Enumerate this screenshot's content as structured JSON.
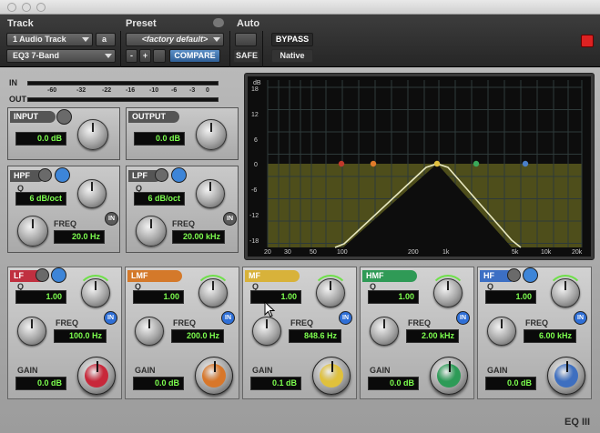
{
  "header": {
    "track_label": "Track",
    "preset_label": "Preset",
    "auto_label": "Auto",
    "track_name": "1 Audio Track",
    "track_sub": "a",
    "plugin_name": "EQ3 7-Band",
    "preset_value": "<factory default>",
    "minus": "-",
    "plus": "+",
    "compare": "COMPARE",
    "safe": "SAFE",
    "bypass": "BYPASS",
    "native": "Native"
  },
  "meters": {
    "in_label": "IN",
    "out_label": "OUT",
    "scale": [
      "-60",
      "-32",
      "-22",
      "-16",
      "-10",
      "-6",
      "-3",
      "0"
    ]
  },
  "input": {
    "label": "INPUT",
    "value": "0.0 dB"
  },
  "output": {
    "label": "OUTPUT",
    "value": "0.0 dB"
  },
  "hpf": {
    "label": "HPF",
    "q_label": "Q",
    "q_value": "6 dB/oct",
    "freq_label": "FREQ",
    "freq_value": "20.0 Hz",
    "in": "IN"
  },
  "lpf": {
    "label": "LPF",
    "q_label": "Q",
    "q_value": "6 dB/oct",
    "freq_label": "FREQ",
    "freq_value": "20.00 kHz",
    "in": "IN"
  },
  "graph": {
    "db_label": "dB",
    "y_ticks": [
      "18",
      "12",
      "6",
      "0",
      "-6",
      "-12",
      "-18"
    ],
    "x_ticks": [
      "20",
      "30",
      "50",
      "100",
      "200",
      "1k",
      "5k",
      "10k",
      "20k"
    ],
    "curve_color": "#e8e8c0",
    "band_colors": [
      "#c0392b",
      "#e07b2a",
      "#e0c040",
      "#3aa85a",
      "#4a7fc8"
    ]
  },
  "bands": [
    {
      "label": "LF",
      "color": "#c03040",
      "q_label": "Q",
      "q_value": "1.00",
      "freq_label": "FREQ",
      "freq_value": "100.0 Hz",
      "gain_label": "GAIN",
      "gain_value": "0.0 dB",
      "in": "IN",
      "knob_color": "#c8283a"
    },
    {
      "label": "LMF",
      "color": "#d4792a",
      "q_label": "Q",
      "q_value": "1.00",
      "freq_label": "FREQ",
      "freq_value": "200.0 Hz",
      "gain_label": "GAIN",
      "gain_value": "0.0 dB",
      "in": "IN",
      "knob_color": "#d8772a"
    },
    {
      "label": "MF",
      "color": "#d8b23a",
      "q_label": "Q",
      "q_value": "1.00",
      "freq_label": "FREQ",
      "freq_value": "848.6 Hz",
      "gain_label": "GAIN",
      "gain_value": "0.1 dB",
      "in": "IN",
      "knob_color": "#e0c13c"
    },
    {
      "label": "HMF",
      "color": "#2f9a56",
      "q_label": "Q",
      "q_value": "1.00",
      "freq_label": "FREQ",
      "freq_value": "2.00 kHz",
      "gain_label": "GAIN",
      "gain_value": "0.0 dB",
      "in": "IN",
      "knob_color": "#2d9b57"
    },
    {
      "label": "HF",
      "color": "#3c6fc4",
      "q_label": "Q",
      "q_value": "1.00",
      "freq_label": "FREQ",
      "freq_value": "6.00 kHz",
      "gain_label": "GAIN",
      "gain_value": "0.0 dB",
      "in": "IN",
      "knob_color": "#3e6fc0"
    }
  ],
  "footer": {
    "product": "EQ III"
  }
}
